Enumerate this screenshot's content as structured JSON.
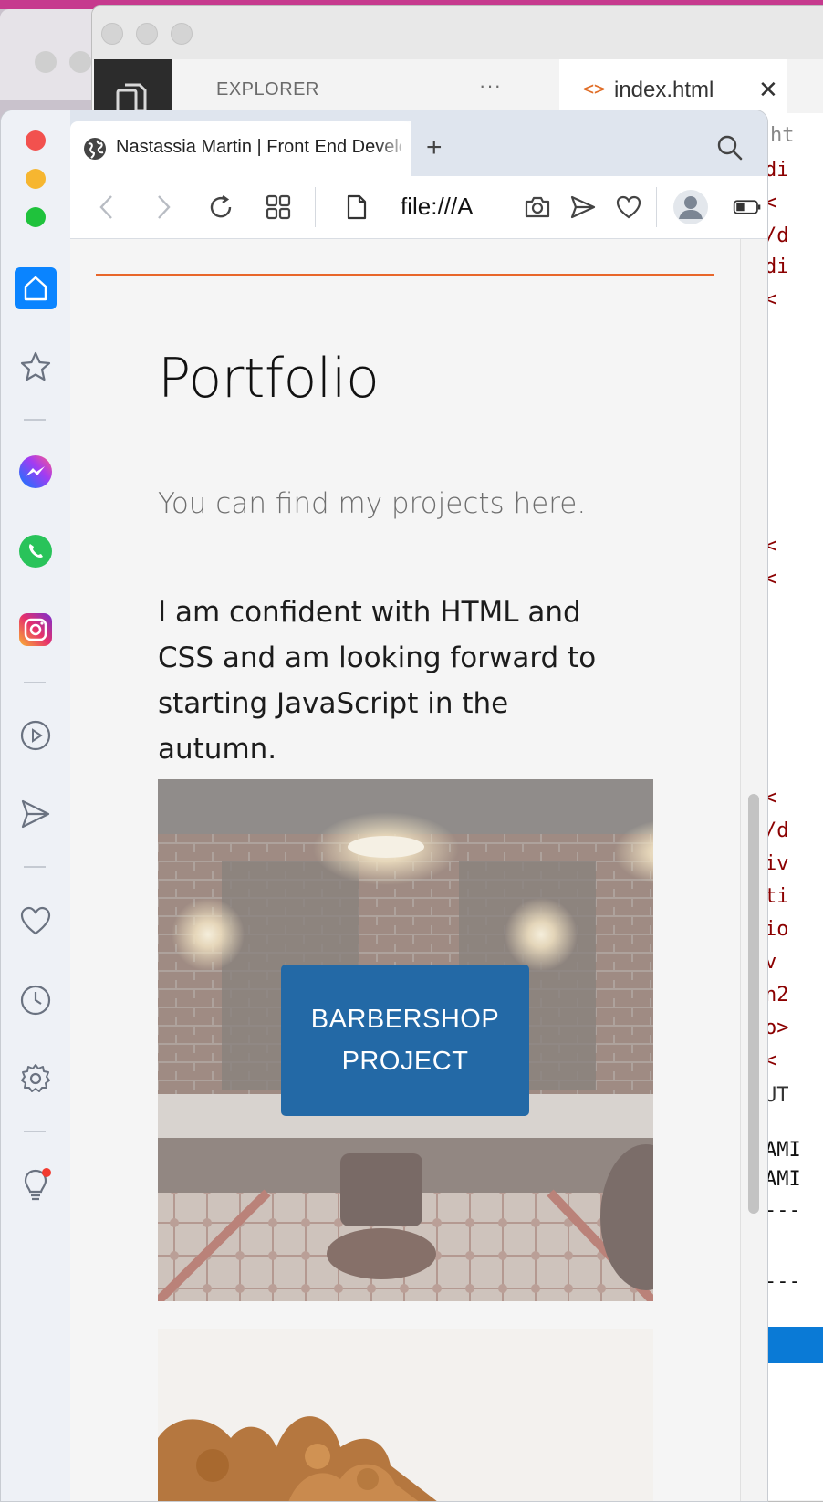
{
  "vscode": {
    "explorer_label": "EXPLORER",
    "more_label": "···",
    "tab_icon": "<>",
    "tab_name": "index.html",
    "tab_close": "✕",
    "code_fragments": [
      "ht",
      "di",
      " <",
      "/d",
      "di",
      " <",
      " <",
      " <",
      " <",
      "/d",
      "iv",
      "ti",
      "io",
      "v",
      "n2",
      "o>",
      " <",
      "UT",
      "AMI",
      "AMI",
      "---",
      "---"
    ]
  },
  "browser": {
    "tab_title": "Nastassia Martin | Front End Developer",
    "new_tab_label": "+",
    "url": "file:///A",
    "sidebar_icons": [
      "home-icon",
      "star-icon",
      "messenger-icon",
      "whatsapp-icon",
      "instagram-icon",
      "play-icon",
      "send-icon",
      "heart-icon",
      "clock-icon",
      "settings-icon",
      "lightbulb-icon"
    ],
    "accent_color": "#0a84ff"
  },
  "page": {
    "heading": "Portfolio",
    "subheading": "You can find my projects here.",
    "paragraph": "I am confident with HTML and CSS and am looking forward to starting JavaScript in the autumn.",
    "project_button_line1": "BARBERSHOP",
    "project_button_line2": "PROJECT",
    "rule_color": "#e8662a",
    "button_color": "#2369a6"
  }
}
